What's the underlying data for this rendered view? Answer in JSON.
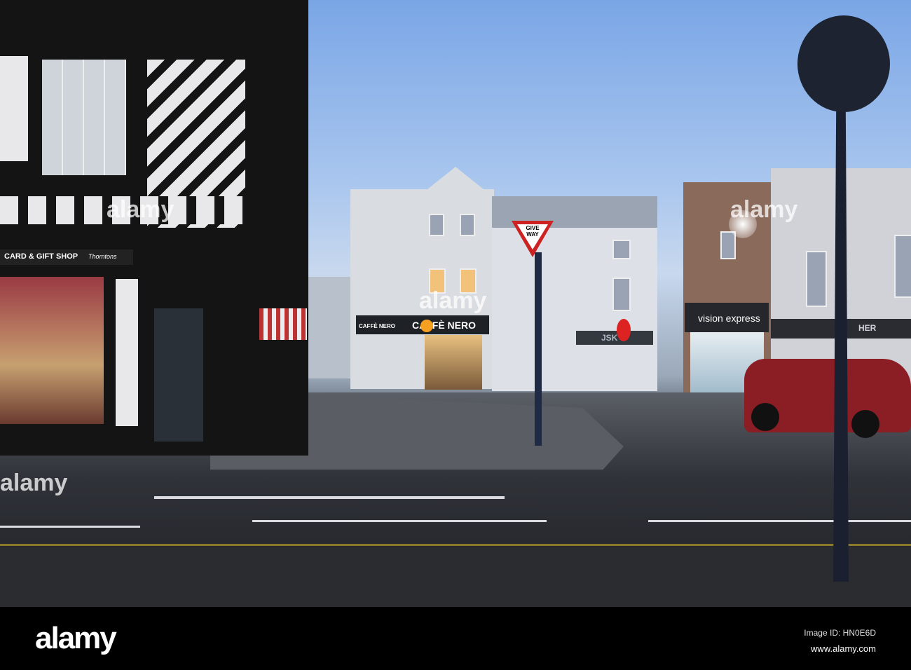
{
  "photo": {
    "shop_signs": {
      "card_shop": "CARD & GIFT SHOP",
      "thorntons": "Thorntons",
      "cafe": "CAFFÈ NERO",
      "cafe_side": "CAFFÈ NERO",
      "jsk": "JSK",
      "vision": "vision express",
      "her": "HER"
    },
    "road_sign": {
      "give_way": "GIVE WAY"
    },
    "watermarks": [
      "alamy",
      "alamy",
      "alamy",
      "alamy"
    ]
  },
  "footer": {
    "logo": "alamy",
    "image_id": "Image ID: HN0E6D",
    "url": "www.alamy.com"
  }
}
